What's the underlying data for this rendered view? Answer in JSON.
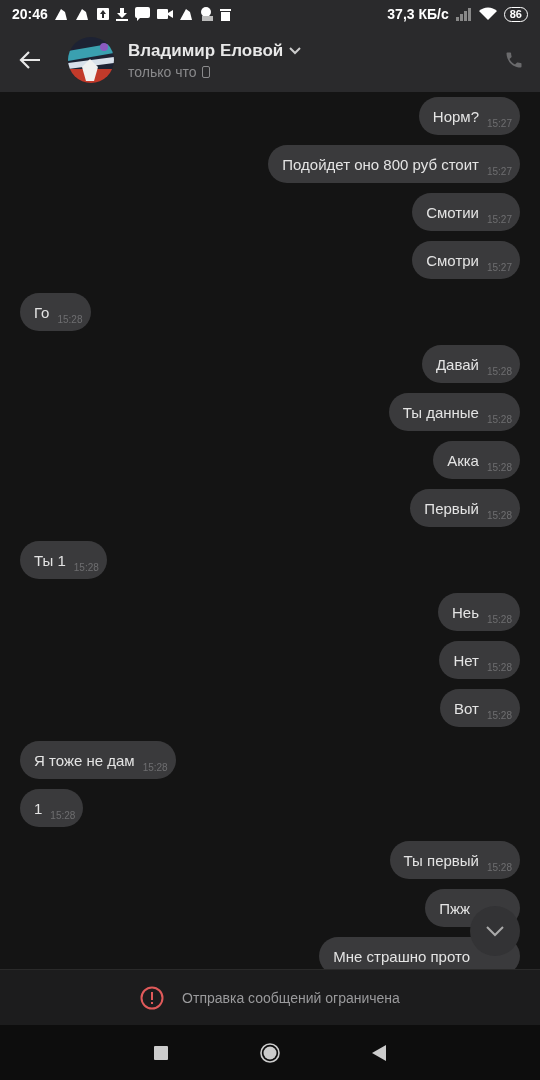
{
  "status_bar": {
    "time": "20:46",
    "speed": "37,3 КБ/с",
    "battery": "86"
  },
  "header": {
    "name": "Владимир Еловой",
    "status": "только что"
  },
  "messages": [
    {
      "text": "Норм?",
      "time": "15:27",
      "outgoing": true
    },
    {
      "text": "Подойдет оно 800 руб стоит",
      "time": "15:27",
      "outgoing": true
    },
    {
      "text": "Смотии",
      "time": "15:27",
      "outgoing": true
    },
    {
      "text": "Смотри",
      "time": "15:27",
      "outgoing": true
    },
    {
      "text": "Го",
      "time": "15:28",
      "outgoing": false
    },
    {
      "text": "Давай",
      "time": "15:28",
      "outgoing": true
    },
    {
      "text": "Ты данные",
      "time": "15:28",
      "outgoing": true
    },
    {
      "text": "Акка",
      "time": "15:28",
      "outgoing": true
    },
    {
      "text": "Первый",
      "time": "15:28",
      "outgoing": true
    },
    {
      "text": "Ты 1",
      "time": "15:28",
      "outgoing": false
    },
    {
      "text": "Неь",
      "time": "15:28",
      "outgoing": true
    },
    {
      "text": "Нет",
      "time": "15:28",
      "outgoing": true
    },
    {
      "text": "Вот",
      "time": "15:28",
      "outgoing": true
    },
    {
      "text": "Я тоже не дам",
      "time": "15:28",
      "outgoing": false
    },
    {
      "text": "1",
      "time": "15:28",
      "outgoing": false
    },
    {
      "text": "Ты первый",
      "time": "15:28",
      "outgoing": true
    },
    {
      "text": "Пжж",
      "outgoing": true
    },
    {
      "text": "Мне страшно прото",
      "outgoing": true
    }
  ],
  "footer": {
    "notice": "Отправка сообщений ограничена"
  }
}
